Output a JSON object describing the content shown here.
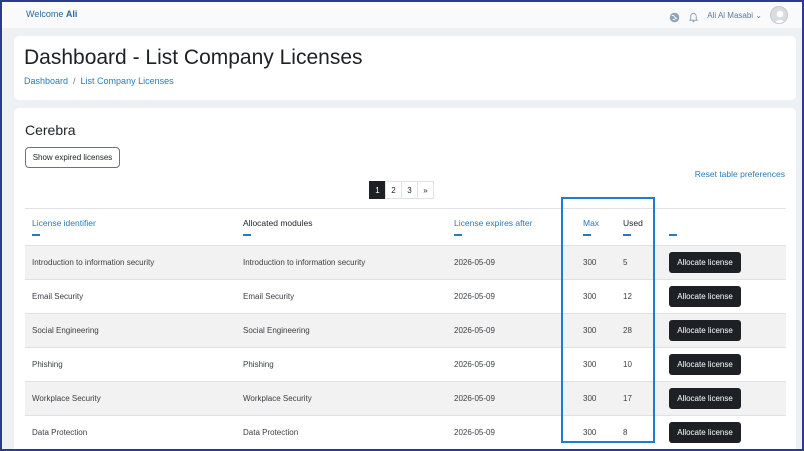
{
  "navbar": {
    "welcome_prefix": "Welcome",
    "welcome_user": "Ali",
    "user_name": "Ali Al Masabi ⌄",
    "icons": [
      "globe-icon",
      "bell-icon",
      "avatar"
    ]
  },
  "header": {
    "title": "Dashboard - List Company Licenses",
    "breadcrumb": [
      "Dashboard",
      "/",
      "List Company Licenses"
    ]
  },
  "section": {
    "title": "Cerebra",
    "show_expired_label": "Show expired licenses",
    "reset_label": "Reset table preferences"
  },
  "pagination": [
    "1",
    "2",
    "3",
    "»"
  ],
  "table": {
    "columns": [
      "License identifier",
      "Allocated modules",
      "License expires after",
      "Max",
      "Used",
      ""
    ],
    "rows": [
      {
        "id": "Introduction to information security",
        "modules": "Introduction to information security",
        "expires": "2026-05-09",
        "max": "300",
        "used": "5",
        "action": "Allocate license"
      },
      {
        "id": "Email Security",
        "modules": "Email Security",
        "expires": "2026-05-09",
        "max": "300",
        "used": "12",
        "action": "Allocate license"
      },
      {
        "id": "Social Engineering",
        "modules": "Social Engineering",
        "expires": "2026-05-09",
        "max": "300",
        "used": "28",
        "action": "Allocate license"
      },
      {
        "id": "Phishing",
        "modules": "Phishing",
        "expires": "2026-05-09",
        "max": "300",
        "used": "10",
        "action": "Allocate license"
      },
      {
        "id": "Workplace Security",
        "modules": "Workplace Security",
        "expires": "2026-05-09",
        "max": "300",
        "used": "17",
        "action": "Allocate license"
      },
      {
        "id": "Data Protection",
        "modules": "Data Protection",
        "expires": "2026-05-09",
        "max": "300",
        "used": "8",
        "action": "Allocate license"
      }
    ]
  },
  "colors": {
    "accent": "#2a7ab9",
    "dark_button": "#1d2125",
    "highlight_box": "#1e7bd6",
    "frame": "#2e3a8c"
  }
}
